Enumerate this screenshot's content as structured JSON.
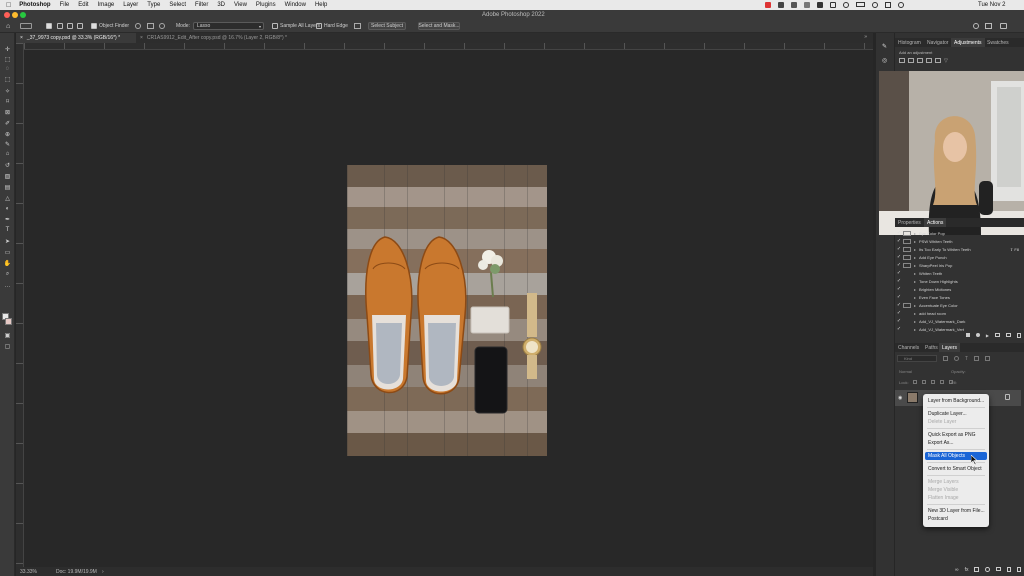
{
  "menubar": {
    "app": "Photoshop",
    "items": [
      "File",
      "Edit",
      "Image",
      "Layer",
      "Type",
      "Select",
      "Filter",
      "3D",
      "View",
      "Plugins",
      "Window",
      "Help"
    ],
    "clock": "Tue Nov 2"
  },
  "window": {
    "title": "Adobe Photoshop 2022"
  },
  "options": {
    "object_finder": "Object Finder",
    "mode_label": "Mode:",
    "mode_value": "Lasso",
    "sample_all_layers": "Sample All Layers",
    "hard_edge": "Hard Edge",
    "select_subject": "Select Subject",
    "select_and_mask": "Select and Mask..."
  },
  "tabs": [
    {
      "label": "_37_9973 copy.psd @ 33.3% (RGB/16*) *",
      "active": true
    },
    {
      "label": "CR1AS9912_Edit_After copy.psd @ 16.7% (Layer 2, RGB/8*) *",
      "active": false
    }
  ],
  "status": {
    "zoom": "33.33%",
    "doc": "Doc: 19.9M/19.9M"
  },
  "top_panel": {
    "tabs": [
      "Histogram",
      "Navigator",
      "Adjustments",
      "Swatches"
    ],
    "active": "Adjustments",
    "hint": "Add an adjustment"
  },
  "actions_panel": {
    "tabs": [
      "Properties",
      "Actions"
    ],
    "active": "Actions",
    "items": [
      {
        "label": "Eye Color Pop",
        "shortcut": ""
      },
      {
        "label": "PSW Whiten Teeth",
        "shortcut": ""
      },
      {
        "label": "Its Too Early To Whiten Teeth",
        "shortcut": "⇧ F8"
      },
      {
        "label": "Add Eye Punch",
        "shortcut": ""
      },
      {
        "label": "SharpPeel Iris Pop",
        "shortcut": ""
      },
      {
        "label": "Whiten Teeth",
        "shortcut": ""
      },
      {
        "label": "Tone Down Highlights",
        "shortcut": ""
      },
      {
        "label": "Brighten Midtones",
        "shortcut": ""
      },
      {
        "label": "Even Face Tones",
        "shortcut": ""
      },
      {
        "label": "Accentuate Eye Color",
        "shortcut": ""
      },
      {
        "label": "add head room",
        "shortcut": ""
      },
      {
        "label": "Add_VJ_Watermark_Dark",
        "shortcut": ""
      },
      {
        "label": "Add_VJ_Watermark_Vert",
        "shortcut": ""
      }
    ]
  },
  "layers_panel": {
    "tabs": [
      "Channels",
      "Paths",
      "Layers"
    ],
    "active": "Layers",
    "kind_placeholder": "Kind",
    "blend": "Normal",
    "opacity_label": "Opacity:",
    "lock_label": "Lock:",
    "fill_label": "Fill:"
  },
  "context_menu": {
    "items": [
      {
        "label": "Layer from Background...",
        "disabled": false
      },
      {
        "label": "Duplicate Layer...",
        "disabled": false
      },
      {
        "label": "Delete Layer",
        "disabled": true
      },
      {
        "label": "Quick Export as PNG",
        "disabled": false
      },
      {
        "label": "Export As...",
        "disabled": false
      },
      {
        "label": "Mask All Objects",
        "disabled": false,
        "highlighted": true
      },
      {
        "label": "Convert to Smart Object",
        "disabled": false
      },
      {
        "label": "Merge Layers",
        "disabled": true
      },
      {
        "label": "Merge Visible",
        "disabled": true
      },
      {
        "label": "Flatten Image",
        "disabled": true
      },
      {
        "label": "New 3D Layer from File...",
        "disabled": false
      },
      {
        "label": "Postcard",
        "disabled": false
      }
    ]
  },
  "colors": {
    "highlight": "#1a65d6",
    "workspace": "#282828",
    "panel": "#323232",
    "shoe": "#c9782e"
  }
}
